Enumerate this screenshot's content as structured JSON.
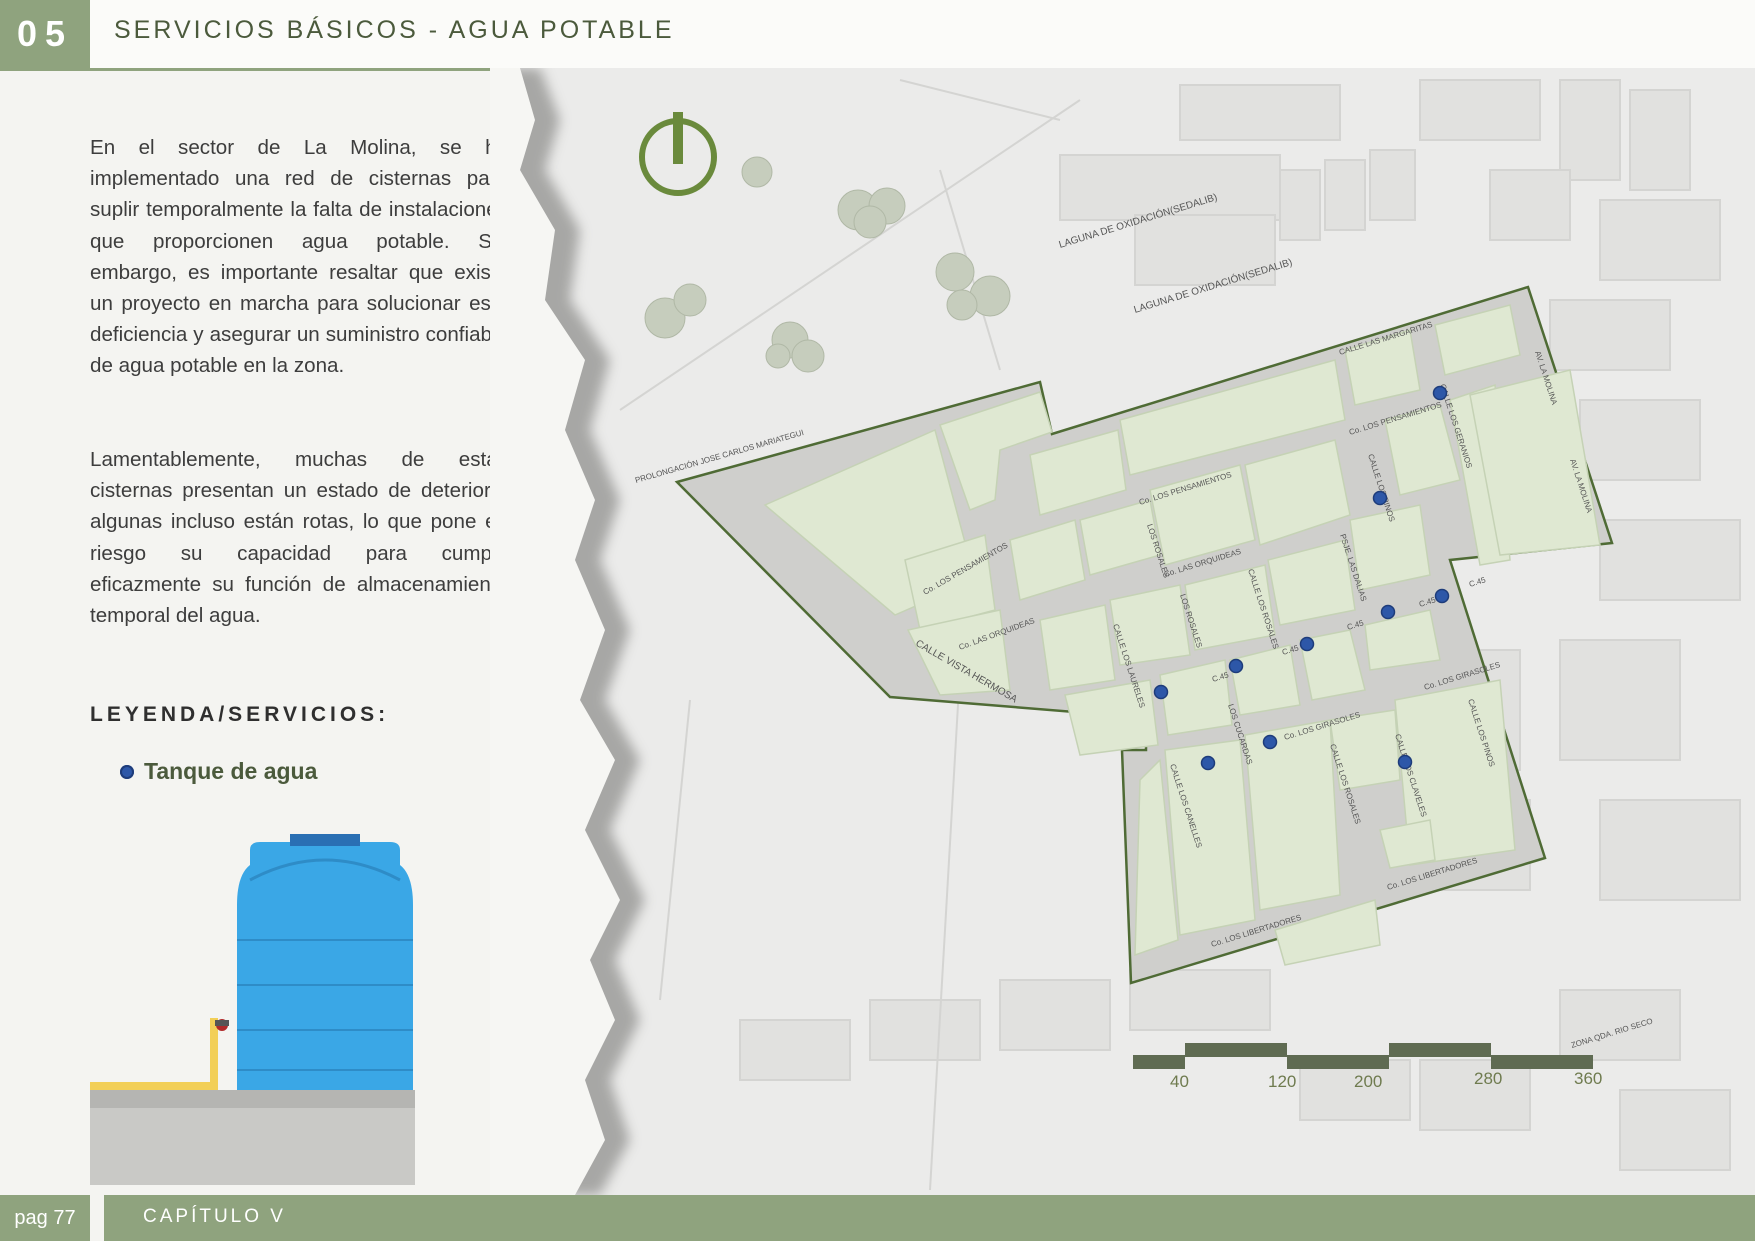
{
  "header": {
    "chapter_number": "05",
    "title": "SERVICIOS BÁSICOS - AGUA POTABLE"
  },
  "body": {
    "paragraph1": "En el sector de La Molina, se ha implementado una red de cisternas para suplir temporalmente la falta de instalaciones que proporcionen agua potable. Sin embargo, es importante resaltar que existe un proyecto en marcha para solucionar esta deficiencia y asegurar un suministro confiable de agua potable en la zona.",
    "paragraph2": "Lamentablemente, muchas de estas cisternas presentan un estado de deterioro, algunas incluso están rotas, lo que pone en riesgo su capacidad para cumplir eficazmente su función de almacenamiento temporal del agua."
  },
  "legend": {
    "title": "LEYENDA/SERVICIOS:",
    "items": [
      {
        "label": "Tanque de agua",
        "symbol": "blue-dot",
        "color": "#2d57a8"
      }
    ]
  },
  "map": {
    "labels": {
      "laguna1": "LAGUNA DE OXIDACIÓN(SEDALIB)",
      "laguna2": "LAGUNA DE OXIDACIÓN(SEDALIB)",
      "prolongacion": "PROLONGACIÓN JOSE CARLOS MARIATEGUI",
      "vista_hermosa": "CALLE VISTA HERMOSA",
      "margaritas": "CALLE LAS MARGARITAS",
      "pensamientos_top": "Co. LOS PENSAMIENTOS",
      "pensamientos_mid": "Co. LOS PENSAMIENTOS",
      "pensamientos_left": "Co. LOS PENSAMIENTOS",
      "orquideas_mid": "Co. LAS ORQUIDEAS",
      "orquideas_left": "Co. LAS ORQUIDEAS",
      "girasoles_right": "Co. LOS GIRASOLES",
      "girasoles_mid": "Co. LOS GIRASOLES",
      "libertadores_bottom": "Co. LOS LIBERTADORES",
      "libertadores_right": "Co. LOS LIBERTADORES",
      "av_molina1": "AV. LA MOLINA",
      "av_molina2": "AV. LA MOLINA",
      "geranios": "CALLE LOS GERANIOS",
      "pinos_top": "CALLE LOS PINOS",
      "pinos_right": "CALLE LOS PINOS",
      "dalias": "PSJE. LAS DALIAS",
      "rosales1": "LOS ROSALES",
      "rosales2": "LOS ROSALES",
      "rosales3": "CALLE LOS ROSALES",
      "rosales4": "CALLE LOS ROSALES",
      "claveles": "CALLE LOS CLAVELES",
      "cucardas": "LOS CUCARDAS",
      "laureles": "CALLE LOS LAURELES",
      "canelles": "CALLE LOS CANELLES",
      "c45_1": "C.45",
      "c45_2": "C.45",
      "c45_3": "C.45",
      "c45_4": "C.45",
      "c45_5": "C.45",
      "rio_seco": "ZONA QDA. RIO SECO"
    },
    "scale": {
      "ticks": [
        "40",
        "120",
        "200",
        "280",
        "360"
      ]
    },
    "water_tanks": [
      {
        "id": 1
      },
      {
        "id": 2
      },
      {
        "id": 3
      },
      {
        "id": 4
      },
      {
        "id": 5
      },
      {
        "id": 6
      },
      {
        "id": 7
      },
      {
        "id": 8
      },
      {
        "id": 9
      },
      {
        "id": 10
      }
    ],
    "colors": {
      "block": "#dfe8d2",
      "road": "#cfcfcc",
      "boundary": "#4f6b35",
      "tank": "#2d57a8",
      "scale": "#5f6b52"
    }
  },
  "footer": {
    "page": "pag 77",
    "chapter": "CAPÍTULO V"
  }
}
